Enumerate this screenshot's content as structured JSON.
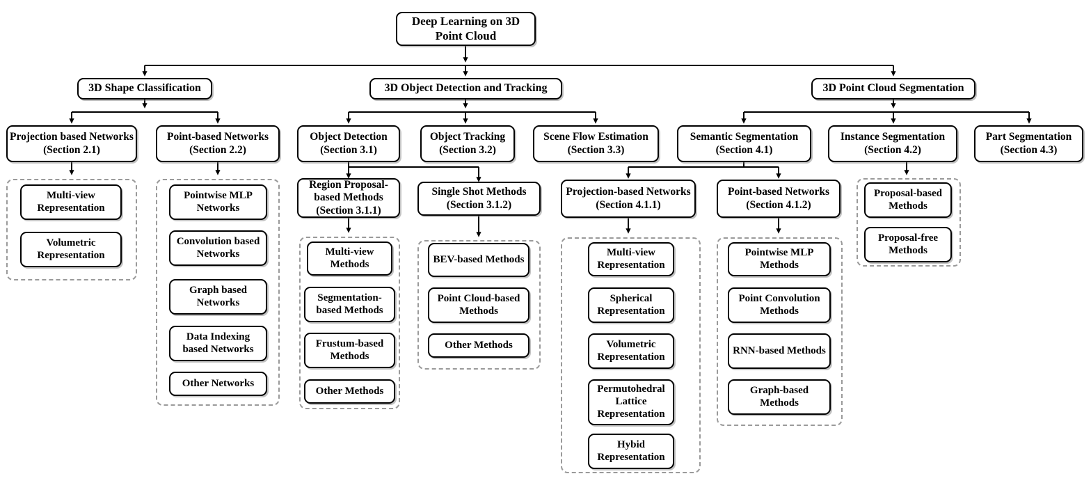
{
  "diagram": {
    "title": "Deep Learning on 3D Point Cloud",
    "type": "taxonomy-tree",
    "root": {
      "id": "root",
      "label": "Deep Learning on 3D Point Cloud"
    },
    "level1": [
      {
        "id": "shape-classification",
        "label": "3D Shape Classification"
      },
      {
        "id": "object-detection-tracking",
        "label": "3D Object Detection and Tracking"
      },
      {
        "id": "point-cloud-segmentation",
        "label": "3D Point Cloud Segmentation"
      }
    ],
    "level2": [
      {
        "id": "projection-based-networks-21",
        "label": "Projection based Networks (Section 2.1)",
        "parent": "shape-classification"
      },
      {
        "id": "point-based-networks-22",
        "label": "Point-based Networks (Section 2.2)",
        "parent": "shape-classification"
      },
      {
        "id": "object-detection-31",
        "label": "Object Detection (Section 3.1)",
        "parent": "object-detection-tracking"
      },
      {
        "id": "object-tracking-32",
        "label": "Object Tracking (Section 3.2)",
        "parent": "object-detection-tracking"
      },
      {
        "id": "scene-flow-estimation-33",
        "label": "Scene Flow Estimation (Section 3.3)",
        "parent": "object-detection-tracking"
      },
      {
        "id": "semantic-segmentation-41",
        "label": "Semantic Segmentation (Section 4.1)",
        "parent": "point-cloud-segmentation"
      },
      {
        "id": "instance-segmentation-42",
        "label": "Instance Segmentation (Section 4.2)",
        "parent": "point-cloud-segmentation"
      },
      {
        "id": "part-segmentation-43",
        "label": "Part Segmentation (Section 4.3)",
        "parent": "point-cloud-segmentation"
      }
    ],
    "level3": [
      {
        "id": "region-proposal-based-methods-311",
        "label": "Region Proposal-based Methods (Section 3.1.1)",
        "parent": "object-detection-31"
      },
      {
        "id": "single-shot-methods-312",
        "label": "Single Shot Methods (Section 3.1.2)",
        "parent": "object-detection-31"
      },
      {
        "id": "projection-based-networks-411",
        "label": "Projection-based Networks (Section 4.1.1)",
        "parent": "semantic-segmentation-41"
      },
      {
        "id": "point-based-networks-412",
        "label": "Point-based Networks (Section 4.1.2)",
        "parent": "semantic-segmentation-41"
      }
    ],
    "leaf_groups": [
      {
        "id": "group-projection-based-networks-21",
        "parent": "projection-based-networks-21",
        "items": [
          {
            "id": "multi-view-representation-21",
            "label": "Multi-view Representation"
          },
          {
            "id": "volumetric-representation-21",
            "label": "Volumetric Representation"
          }
        ]
      },
      {
        "id": "group-point-based-networks-22",
        "parent": "point-based-networks-22",
        "items": [
          {
            "id": "pointwise-mlp-networks",
            "label": "Pointwise MLP Networks"
          },
          {
            "id": "convolution-based-networks",
            "label": "Convolution based Networks"
          },
          {
            "id": "graph-based-networks",
            "label": "Graph based Networks"
          },
          {
            "id": "data-indexing-based-networks",
            "label": "Data Indexing based Networks"
          },
          {
            "id": "other-networks",
            "label": "Other Networks"
          }
        ]
      },
      {
        "id": "group-region-proposal-based-methods",
        "parent": "region-proposal-based-methods-311",
        "items": [
          {
            "id": "multi-view-methods",
            "label": "Multi-view Methods"
          },
          {
            "id": "segmentation-based-methods",
            "label": "Segmentation-based Methods"
          },
          {
            "id": "frustum-based-methods",
            "label": "Frustum-based Methods"
          },
          {
            "id": "other-methods-311",
            "label": "Other Methods"
          }
        ]
      },
      {
        "id": "group-single-shot-methods",
        "parent": "single-shot-methods-312",
        "items": [
          {
            "id": "bev-based-methods",
            "label": "BEV-based Methods"
          },
          {
            "id": "point-cloud-based-methods",
            "label": "Point Cloud-based Methods"
          },
          {
            "id": "other-methods-312",
            "label": "Other Methods"
          }
        ]
      },
      {
        "id": "group-projection-based-networks-411",
        "parent": "projection-based-networks-411",
        "items": [
          {
            "id": "multi-view-representation-411",
            "label": "Multi-view Representation"
          },
          {
            "id": "spherical-representation",
            "label": "Spherical Representation"
          },
          {
            "id": "volumetric-representation-411",
            "label": "Volumetric Representation"
          },
          {
            "id": "permutohedral-lattice-representation",
            "label": "Permutohedral Lattice Representation"
          },
          {
            "id": "hybid-representation",
            "label": "Hybid Representation"
          }
        ]
      },
      {
        "id": "group-point-based-networks-412",
        "parent": "point-based-networks-412",
        "items": [
          {
            "id": "pointwise-mlp-methods",
            "label": "Pointwise MLP Methods"
          },
          {
            "id": "point-convolution-methods",
            "label": "Point Convolution Methods"
          },
          {
            "id": "rnn-based-methods",
            "label": "RNN-based Methods"
          },
          {
            "id": "graph-based-methods",
            "label": "Graph-based Methods"
          }
        ]
      },
      {
        "id": "group-instance-segmentation",
        "parent": "instance-segmentation-42",
        "items": [
          {
            "id": "proposal-based-methods",
            "label": "Proposal-based Methods"
          },
          {
            "id": "proposal-free-methods",
            "label": "Proposal-free Methods"
          }
        ]
      }
    ],
    "colors": {
      "node_border": "#000000",
      "node_fill": "#ffffff",
      "group_border": "#9a9a9a",
      "connector": "#000000",
      "text": "#000000"
    }
  }
}
